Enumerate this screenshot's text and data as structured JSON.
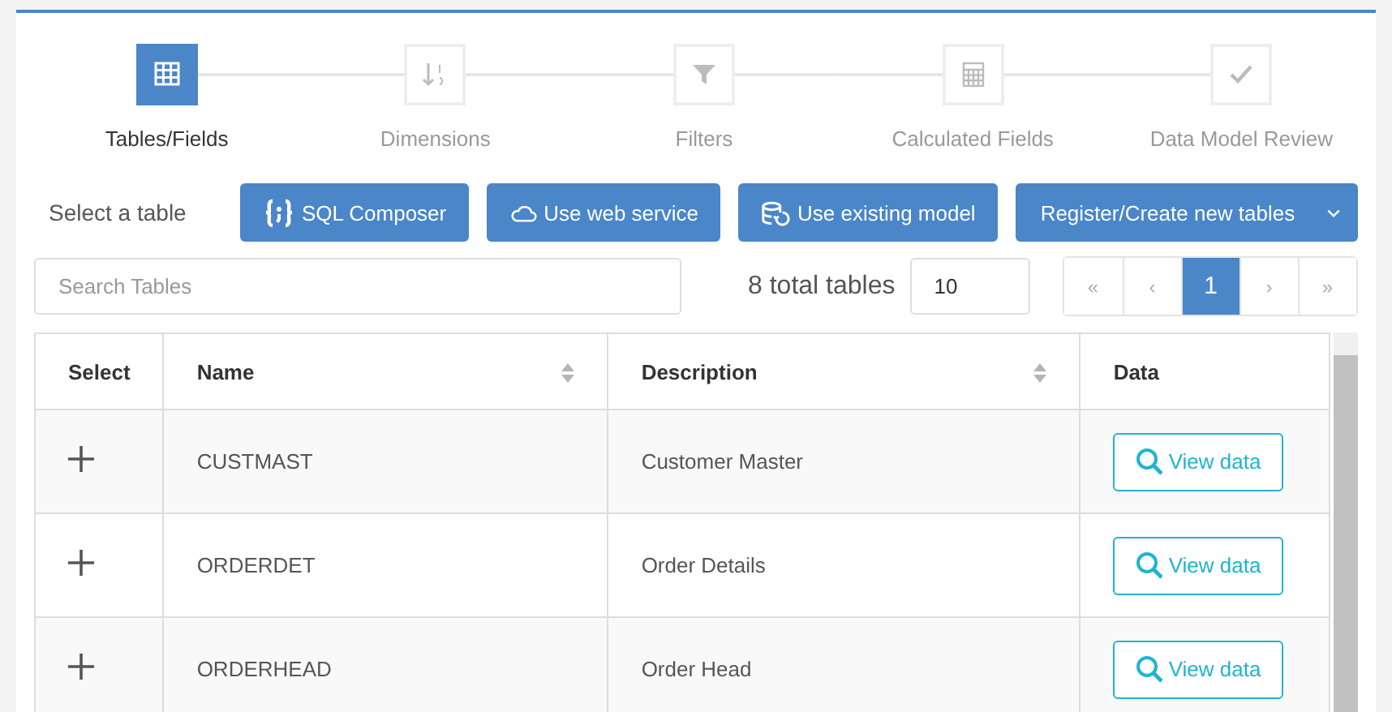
{
  "steps": [
    {
      "label": "Tables/Fields",
      "kind": "grid",
      "selected": true
    },
    {
      "label": "Dimensions",
      "kind": "sort",
      "selected": false
    },
    {
      "label": "Filters",
      "kind": "filter",
      "selected": false
    },
    {
      "label": "Calculated Fields",
      "kind": "calculator",
      "selected": false
    },
    {
      "label": "Data Model Review",
      "kind": "check",
      "selected": false
    }
  ],
  "toolbar": {
    "label": "Select a table",
    "buttons": [
      {
        "label": "SQL Composer",
        "kind": "braces"
      },
      {
        "label": "Use web service",
        "kind": "cloud"
      },
      {
        "label": "Use existing model",
        "kind": "database"
      },
      {
        "label": "Register/Create new tables",
        "kind": "dropdown"
      }
    ]
  },
  "search": {
    "placeholder": "Search Tables"
  },
  "total": "8 total tables",
  "page_size": "10",
  "pagination": [
    {
      "label": "«",
      "selected": false
    },
    {
      "label": "‹",
      "selected": false
    },
    {
      "label": "1",
      "selected": true
    },
    {
      "label": "›",
      "selected": false
    },
    {
      "label": "»",
      "selected": false
    }
  ],
  "table": {
    "columns": [
      {
        "label": "Select",
        "sortable": false
      },
      {
        "label": "Name",
        "sortable": true
      },
      {
        "label": "Description",
        "sortable": true
      },
      {
        "label": "Data",
        "sortable": false
      }
    ],
    "rows": [
      {
        "name": "CUSTMAST",
        "description": "Customer Master",
        "action": "View data"
      },
      {
        "name": "ORDERDET",
        "description": "Order Details",
        "action": "View data"
      },
      {
        "name": "ORDERHEAD",
        "description": "Order Head",
        "action": "View data"
      }
    ]
  }
}
